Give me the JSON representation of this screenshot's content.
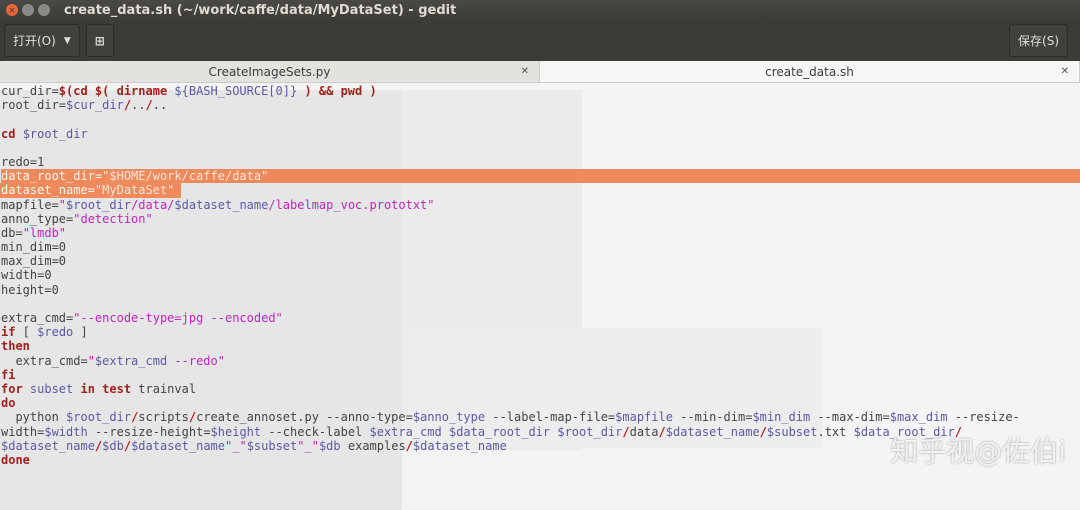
{
  "window": {
    "title": "create_data.sh (~/work/caffe/data/MyDataSet) - gedit"
  },
  "toolbar": {
    "open_label": "打开(O)",
    "open_icon": "chevron-down-icon",
    "new_icon": "new-document-icon",
    "save_label": "保存(S)"
  },
  "tabs": [
    {
      "label": "CreateImageSets.py",
      "active": false
    },
    {
      "label": "create_data.sh",
      "active": true
    }
  ],
  "colors": {
    "highlight": "#ef8a5c",
    "variable": "#5a5aa8",
    "keyword": "#a0221c",
    "string": "#c026c0"
  },
  "watermark": "知乎视@佐伯i",
  "code": [
    {
      "t": [
        [
          "pl",
          "cur_dir="
        ],
        [
          "kw",
          "$(cd $( dirname "
        ],
        [
          "var",
          "${BASH_SOURCE[0]}"
        ],
        [
          "kw",
          " ) && pwd )"
        ]
      ]
    },
    {
      "t": [
        [
          "pl",
          "root_dir="
        ],
        [
          "var",
          "$cur_dir"
        ],
        [
          "op",
          "/"
        ],
        [
          "pl",
          ".."
        ],
        [
          "op",
          "/"
        ],
        [
          "pl",
          ".."
        ]
      ]
    },
    {
      "t": []
    },
    {
      "t": [
        [
          "kw",
          "cd "
        ],
        [
          "var",
          "$root_dir"
        ]
      ]
    },
    {
      "t": []
    },
    {
      "t": [
        [
          "pl",
          "redo=1"
        ]
      ]
    },
    {
      "hl": "full",
      "t": [
        [
          "pl",
          "data_root_dir="
        ],
        [
          "str",
          "\"$HOME/work/caffe/data\""
        ]
      ]
    },
    {
      "hl": "part",
      "t": [
        [
          "pl",
          "dataset_name="
        ],
        [
          "str",
          "\"MyDataSet\""
        ]
      ]
    },
    {
      "t": [
        [
          "pl",
          "mapfile="
        ],
        [
          "str",
          "\""
        ],
        [
          "var",
          "$root_dir"
        ],
        [
          "str",
          "/data/"
        ],
        [
          "var",
          "$dataset_name"
        ],
        [
          "str",
          "/labelmap_voc.prototxt\""
        ]
      ]
    },
    {
      "t": [
        [
          "pl",
          "anno_type="
        ],
        [
          "str",
          "\"detection\""
        ]
      ]
    },
    {
      "t": [
        [
          "pl",
          "db="
        ],
        [
          "str",
          "\"lmdb\""
        ]
      ]
    },
    {
      "t": [
        [
          "pl",
          "min_dim=0"
        ]
      ]
    },
    {
      "t": [
        [
          "pl",
          "max_dim=0"
        ]
      ]
    },
    {
      "t": [
        [
          "pl",
          "width=0"
        ]
      ]
    },
    {
      "t": [
        [
          "pl",
          "height=0"
        ]
      ]
    },
    {
      "t": []
    },
    {
      "t": [
        [
          "pl",
          "extra_cmd="
        ],
        [
          "str",
          "\"--encode-type=jpg --encoded\""
        ]
      ]
    },
    {
      "t": [
        [
          "kw",
          "if"
        ],
        [
          "pl",
          " [ "
        ],
        [
          "var",
          "$redo"
        ],
        [
          "pl",
          " ]"
        ]
      ]
    },
    {
      "t": [
        [
          "kw",
          "then"
        ]
      ]
    },
    {
      "t": [
        [
          "pl",
          "  extra_cmd="
        ],
        [
          "str",
          "\""
        ],
        [
          "var",
          "$extra_cmd"
        ],
        [
          "str",
          " --redo\""
        ]
      ]
    },
    {
      "t": [
        [
          "kw",
          "fi"
        ]
      ]
    },
    {
      "t": [
        [
          "kw",
          "for"
        ],
        [
          "var",
          " subset "
        ],
        [
          "kw",
          "in test"
        ],
        [
          "pl",
          " trainval"
        ]
      ]
    },
    {
      "t": [
        [
          "kw",
          "do"
        ]
      ]
    },
    {
      "t": [
        [
          "pl",
          "  python "
        ],
        [
          "var",
          "$root_dir"
        ],
        [
          "op",
          "/"
        ],
        [
          "pl",
          "scripts"
        ],
        [
          "op",
          "/"
        ],
        [
          "pl",
          "create_annoset.py --anno-type="
        ],
        [
          "var",
          "$anno_type"
        ],
        [
          "pl",
          " --label-map-file="
        ],
        [
          "var",
          "$mapfile"
        ],
        [
          "pl",
          " --min-dim="
        ],
        [
          "var",
          "$min_dim"
        ],
        [
          "pl",
          " --max-dim="
        ],
        [
          "var",
          "$max_dim"
        ],
        [
          "pl",
          " --resize-"
        ]
      ]
    },
    {
      "t": [
        [
          "pl",
          "width="
        ],
        [
          "var",
          "$width"
        ],
        [
          "pl",
          " --resize-height="
        ],
        [
          "var",
          "$height"
        ],
        [
          "pl",
          " --check-label "
        ],
        [
          "var",
          "$extra_cmd $data_root_dir $root_dir"
        ],
        [
          "op",
          "/"
        ],
        [
          "pl",
          "data"
        ],
        [
          "op",
          "/"
        ],
        [
          "var",
          "$dataset_name"
        ],
        [
          "op",
          "/"
        ],
        [
          "var",
          "$subset"
        ],
        [
          "pl",
          ".txt "
        ],
        [
          "var",
          "$data_root_dir"
        ],
        [
          "op",
          "/"
        ]
      ]
    },
    {
      "t": [
        [
          "var",
          "$dataset_name"
        ],
        [
          "op",
          "/"
        ],
        [
          "var",
          "$db"
        ],
        [
          "op",
          "/"
        ],
        [
          "var",
          "$dataset_name"
        ],
        [
          "str",
          "\"_\""
        ],
        [
          "var",
          "$subset"
        ],
        [
          "str",
          "\"_\""
        ],
        [
          "var",
          "$db"
        ],
        [
          "pl",
          " examples"
        ],
        [
          "op",
          "/"
        ],
        [
          "var",
          "$dataset_name"
        ]
      ]
    },
    {
      "t": [
        [
          "kw",
          "done"
        ]
      ]
    }
  ]
}
